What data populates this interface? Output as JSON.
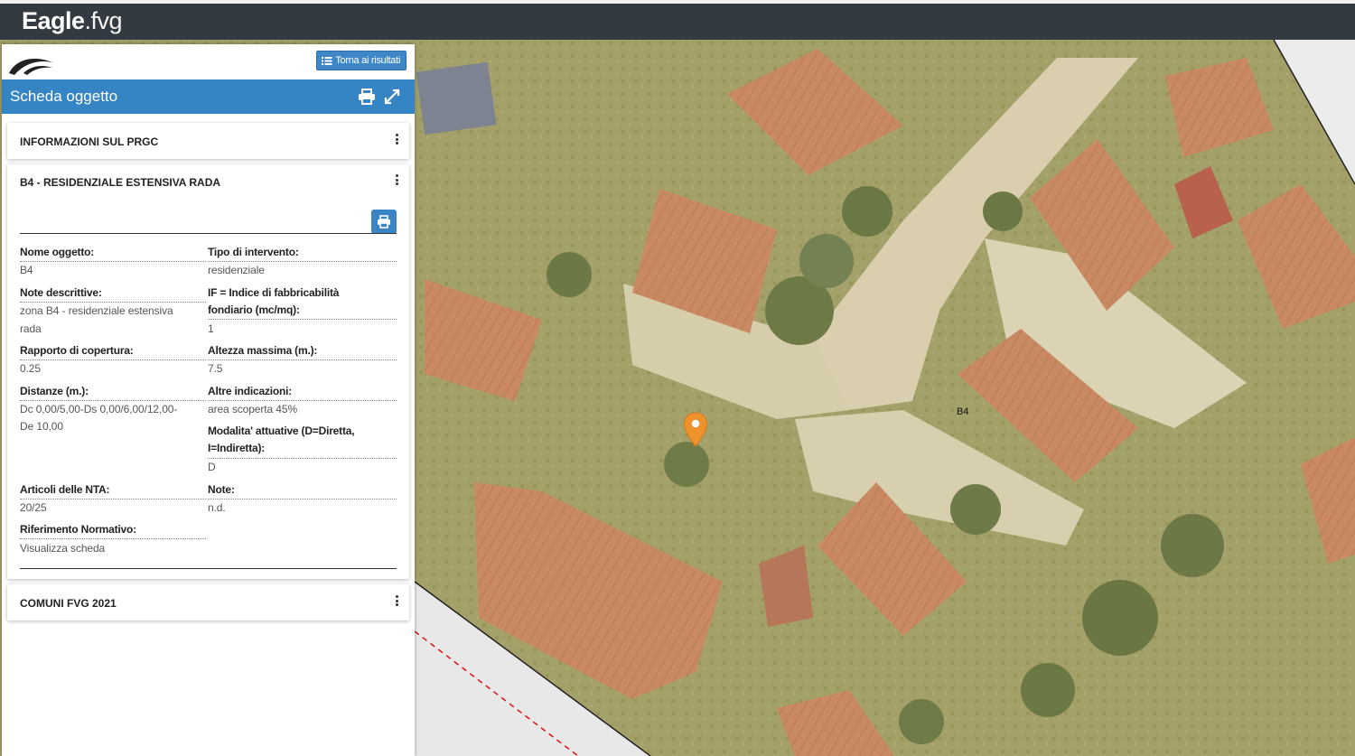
{
  "app": {
    "logo_bold": "Eagle",
    "logo_light": ".fvg"
  },
  "panel": {
    "back_button": "Torna ai risultati",
    "title": "Scheda oggetto",
    "sections": {
      "prgc": "INFORMAZIONI SUL PRGC",
      "zone": "B4 - RESIDENZIALE ESTENSIVA RADA",
      "comuni": "COMUNI FVG 2021"
    },
    "fields": {
      "nome_label": "Nome oggetto:",
      "nome_value": "B4",
      "tipo_label": "Tipo di intervento:",
      "tipo_value": "residenziale",
      "note_descr_label": "Note descrittive:",
      "note_descr_value_1": "zona B4 - residenziale estensiva",
      "note_descr_value_2": "rada",
      "if_label_1": "IF = Indice di fabbricabilità",
      "if_label_2": "fondiario (mc/mq):",
      "if_value": "1",
      "rapporto_label": "Rapporto di copertura:",
      "rapporto_value": "0.25",
      "altezza_label": "Altezza massima (m.):",
      "altezza_value": "7.5",
      "distanze_label": "Distanze (m.):",
      "distanze_value_1": "Dc 0,00/5,00-Ds 0,00/6,00/12,00-",
      "distanze_value_2": "De 10,00",
      "altre_label": "Altre indicazioni:",
      "altre_value": "area scoperta 45%",
      "modalita_label_1": "Modalita' attuative (D=Diretta,",
      "modalita_label_2": "I=Indiretta):",
      "modalita_value": "D",
      "articoli_label": "Articoli delle NTA:",
      "articoli_value": "20/25",
      "note_label": "Note:",
      "note_value": "n.d.",
      "riferimento_label": "Riferimento Normativo:",
      "riferimento_value": "Visualizza scheda"
    }
  },
  "map": {
    "zone_label": "B4",
    "marker_color": "#f0922b"
  },
  "colors": {
    "accent": "#3584c3",
    "topbar": "#333a41"
  }
}
